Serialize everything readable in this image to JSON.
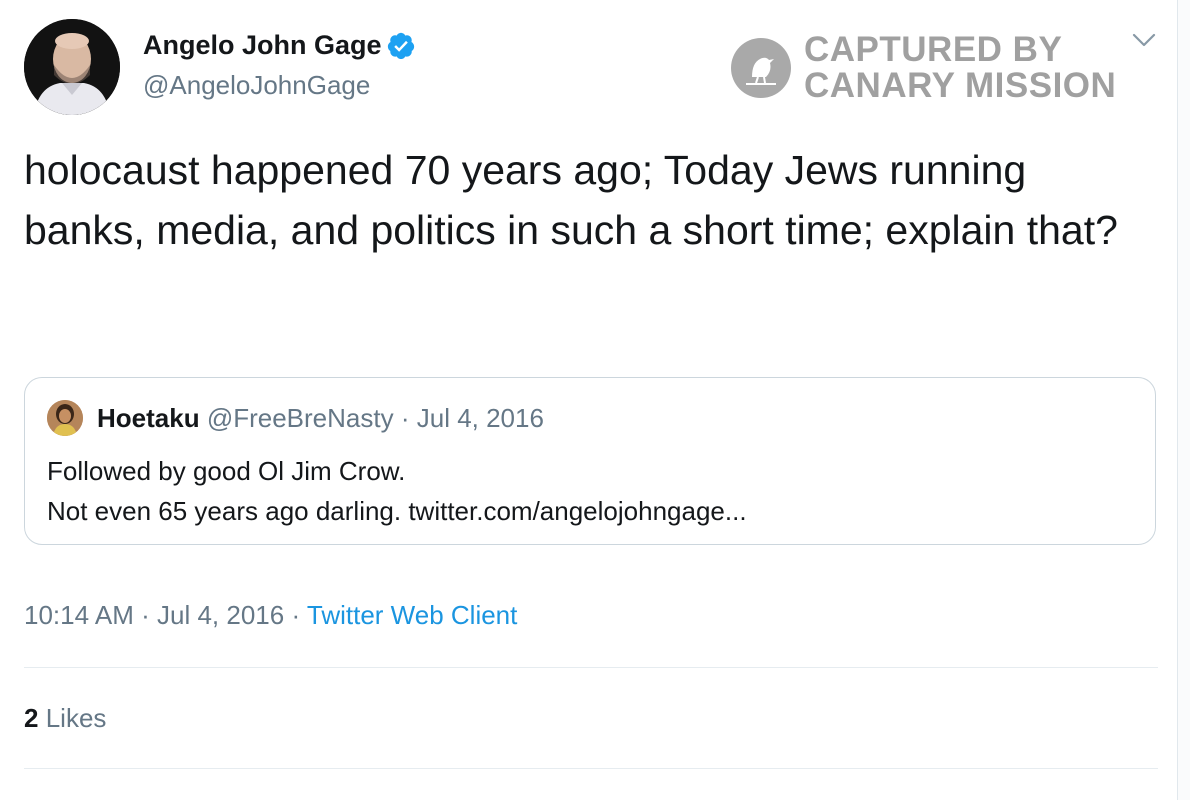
{
  "author": {
    "display_name": "Angelo John Gage",
    "handle": "@AngeloJohnGage",
    "verified": true,
    "verified_color": "#1da1f2"
  },
  "watermark": {
    "line1": "CAPTURED BY",
    "line2": "CANARY MISSION"
  },
  "tweet": {
    "text": "holocaust happened 70 years ago; Today Jews running banks, media, and politics in such a short time; explain that?"
  },
  "quoted_tweet": {
    "display_name": "Hoetaku",
    "handle": "@FreeBreNasty",
    "separator": "·",
    "date": "Jul 4, 2016",
    "line1": "Followed by good Ol Jim Crow.",
    "line2": "Not even 65 years ago darling. twitter.com/angelojohngage..."
  },
  "meta": {
    "time": "10:14 AM",
    "sep1": "·",
    "date": "Jul 4, 2016",
    "sep2": "·",
    "source": "Twitter Web Client"
  },
  "stats": {
    "likes_count": "2",
    "likes_label": "Likes"
  },
  "icons": {
    "menu": "chevron-down-icon",
    "verified": "verified-badge-icon",
    "watermark": "canary-logo-icon"
  },
  "colors": {
    "link": "#1b95e0",
    "secondary_text": "#657786",
    "primary_text": "#14171a",
    "watermark": "#a0a0a0"
  }
}
